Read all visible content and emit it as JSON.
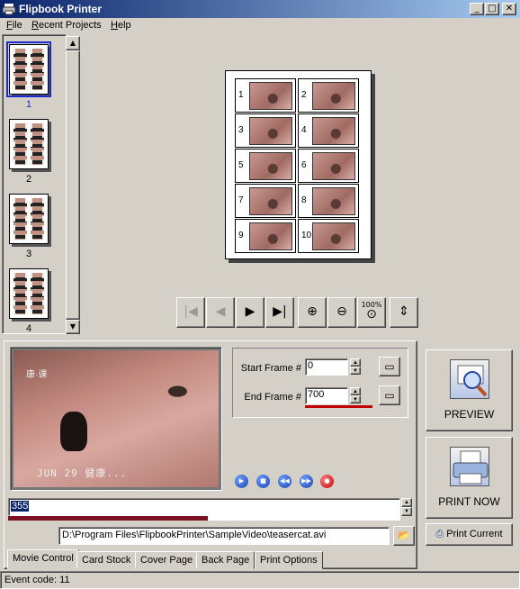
{
  "window": {
    "title": "Flipbook Printer",
    "controls": [
      "minimize",
      "maximize",
      "close"
    ]
  },
  "menu": {
    "items": [
      {
        "label": "File",
        "u": "F",
        "rest": "ile"
      },
      {
        "label": "Recent Projects",
        "u": "R",
        "rest": "ecent Projects"
      },
      {
        "label": "Help",
        "u": "H",
        "rest": "elp"
      }
    ]
  },
  "pages": {
    "items": [
      "1",
      "2",
      "3",
      "4"
    ],
    "selected_index": 0
  },
  "sheet": {
    "cells": [
      "1",
      "2",
      "3",
      "4",
      "5",
      "6",
      "7",
      "8",
      "9",
      "10"
    ]
  },
  "preview_toolbar": {
    "buttons": [
      "first-page-icon",
      "prev-page-icon",
      "next-page-icon",
      "last-page-icon",
      "zoom-in-icon",
      "zoom-out-icon",
      "zoom-100-icon",
      "fit-page-icon"
    ],
    "zoom_100_label": "100%"
  },
  "video": {
    "date_stamp": "JUN 29  健康...",
    "logo_text": "康·课"
  },
  "frames": {
    "start_label": "Start Frame #",
    "start_value": "0",
    "end_label": "End Frame #",
    "end_value": "700"
  },
  "playback_buttons": [
    "play-icon",
    "stop-icon",
    "rewind-icon",
    "forward-icon",
    "record-icon"
  ],
  "progress": {
    "value": "355",
    "fraction": 0.51
  },
  "file_path": "D:\\Program Files\\FlipbookPrinter\\SampleVideo\\teasercat.avi",
  "tabs": [
    {
      "label": "Movie Control",
      "active": true
    },
    {
      "label": "Card Stock",
      "active": false
    },
    {
      "label": "Cover Page",
      "active": false
    },
    {
      "label": "Back Page",
      "active": false
    },
    {
      "label": "Print Options",
      "active": false
    }
  ],
  "actions": {
    "preview": "PREVIEW",
    "print_now": "PRINT NOW",
    "print_current": "Print Current"
  },
  "status": {
    "text": "Event code: 11"
  },
  "colors": {
    "titlebar_start": "#0a246a",
    "titlebar_end": "#a6caf0",
    "selection": "#1c2bcf",
    "progress_fill": "#7a1020",
    "end_frame_underline": "#c00000"
  }
}
